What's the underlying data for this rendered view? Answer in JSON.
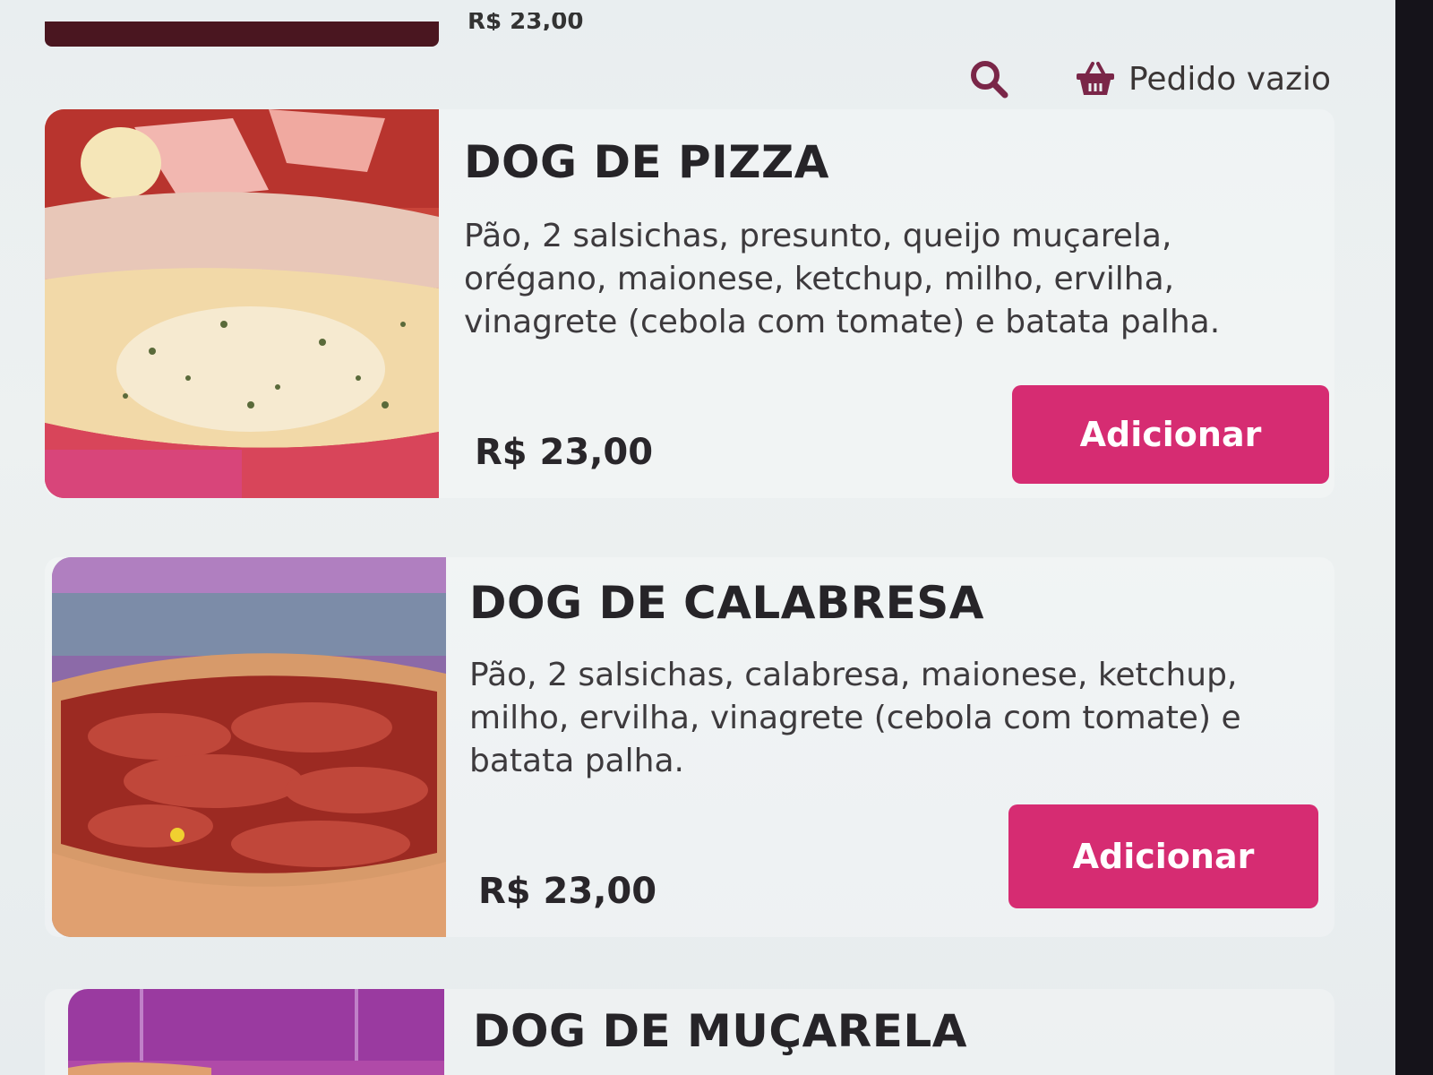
{
  "previous_item": {
    "price_fragment": "R$ 23,00"
  },
  "header": {
    "search_icon": "search-icon",
    "cart_icon": "basket-icon",
    "cart_label": "Pedido vazio"
  },
  "products": [
    {
      "name": "DOG DE PIZZA",
      "description": "Pão, 2 salsichas, presunto, queijo muçarela, orégano, maionese, ketchup, milho, ervilha, vinagrete (cebola com tomate) e batata palha.",
      "price": "R$ 23,00",
      "button_label": "Adicionar"
    },
    {
      "name": "DOG DE CALABRESA",
      "description": "Pão, 2 salsichas, calabresa, maionese, ketchup, milho, ervilha, vinagrete (cebola com tomate) e batata palha.",
      "price": "R$ 23,00",
      "button_label": "Adicionar"
    },
    {
      "name": "DOG DE MUÇARELA"
    }
  ],
  "colors": {
    "accent": "#d62c72",
    "text": "#262428",
    "background": "#eaeff0"
  }
}
